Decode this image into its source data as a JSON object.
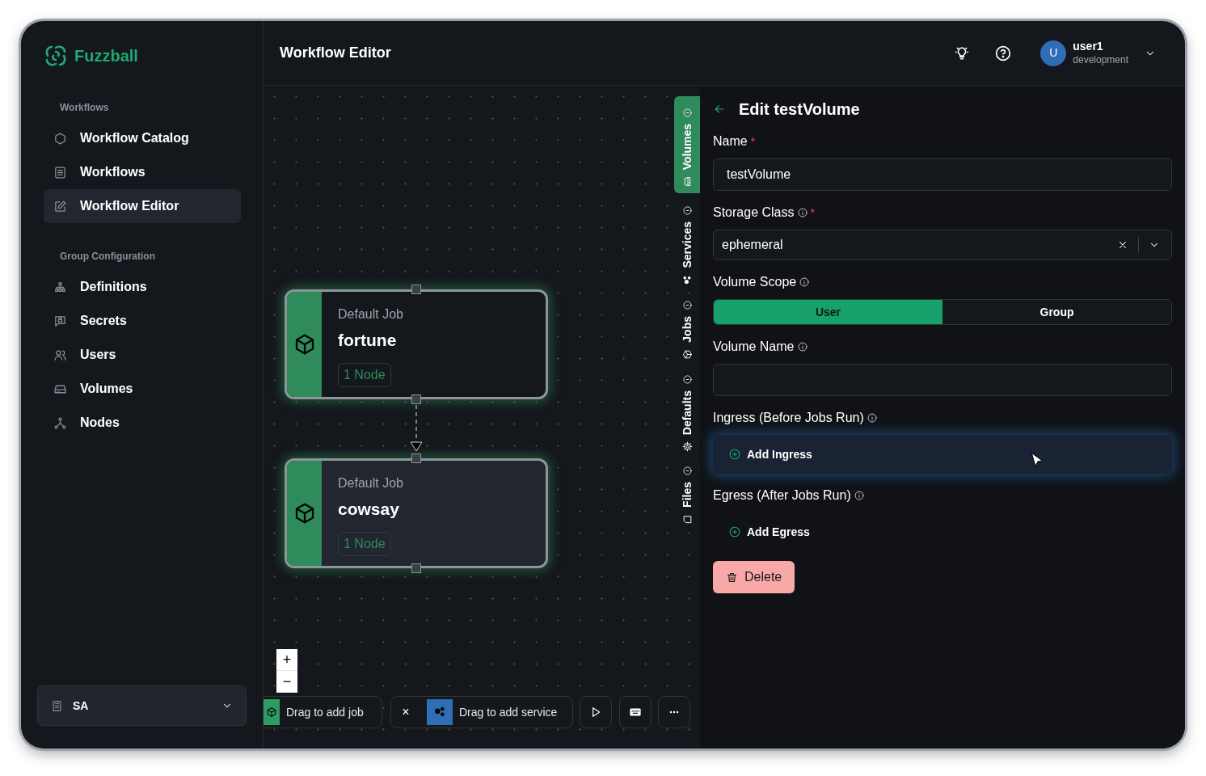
{
  "brand": "Fuzzball",
  "sidebar": {
    "sections": [
      {
        "title": "Workflows",
        "items": [
          {
            "label": "Workflow Catalog",
            "selected": false
          },
          {
            "label": "Workflows",
            "selected": false
          },
          {
            "label": "Workflow Editor",
            "selected": true
          }
        ]
      },
      {
        "title": "Group Configuration",
        "items": [
          {
            "label": "Definitions",
            "selected": false
          },
          {
            "label": "Secrets",
            "selected": false
          },
          {
            "label": "Users",
            "selected": false
          },
          {
            "label": "Volumes",
            "selected": false
          },
          {
            "label": "Nodes",
            "selected": false
          }
        ]
      }
    ]
  },
  "org_selector": {
    "value": "SA"
  },
  "header": {
    "title": "Workflow Editor",
    "user": {
      "initial": "U",
      "name": "user1",
      "environment": "development"
    }
  },
  "canvas": {
    "nodes": [
      {
        "kind_label": "Default Job",
        "name": "fortune",
        "badge": "1 Node",
        "hovered": false
      },
      {
        "kind_label": "Default Job",
        "name": "cowsay",
        "badge": "1 Node",
        "hovered": true
      }
    ],
    "zoom_controls": [
      "+",
      "−"
    ],
    "toolbar": {
      "job_hint": "Drag to add job",
      "close": "×",
      "service_hint": "Drag to add service"
    }
  },
  "side_tabs": [
    {
      "label": "Volumes",
      "selected": true
    },
    {
      "label": "Services",
      "selected": false
    },
    {
      "label": "Jobs",
      "selected": false
    },
    {
      "label": "Defaults",
      "selected": false
    },
    {
      "label": "Files",
      "selected": false
    }
  ],
  "panel": {
    "title": "Edit testVolume",
    "fields": [
      {
        "kind": "text",
        "label": "Name",
        "info": false,
        "required_mark": "*",
        "value": "testVolume"
      },
      {
        "kind": "select",
        "label": "Storage Class",
        "info": true,
        "required_mark": "*",
        "value": "ephemeral"
      },
      {
        "kind": "segmented",
        "label": "Volume Scope",
        "info": true,
        "options": [
          {
            "label": "User",
            "selected": true
          },
          {
            "label": "Group",
            "selected": false
          }
        ]
      },
      {
        "kind": "text",
        "label": "Volume Name",
        "info": true
      },
      {
        "kind": "action",
        "label": "Ingress (Before Jobs Run)",
        "info": true,
        "button": "Add Ingress",
        "focused": true
      },
      {
        "kind": "action",
        "label": "Egress (After Jobs Run)",
        "info": true,
        "button": "Add Egress",
        "focused": false
      }
    ],
    "delete_button": "Delete"
  }
}
